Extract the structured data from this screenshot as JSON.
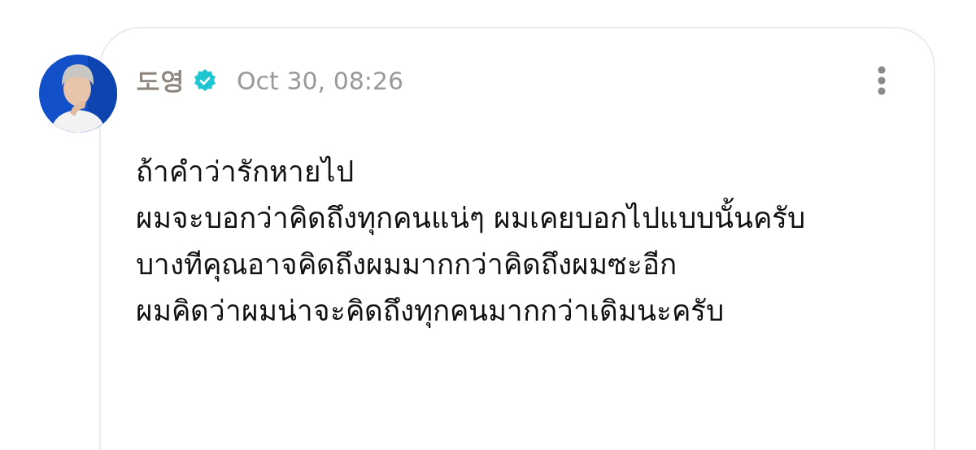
{
  "post": {
    "author": "도영",
    "verified": true,
    "time": "Oct 30, 08:26",
    "body": "ถ้าคำว่ารักหายไป\nผมจะบอกว่าคิดถึงทุกคนแน่ๆ ผมเคยบอกไปแบบนั้นครับ\nบางทีคุณอาจคิดถึงผมมากกว่าคิดถึงผมซะอีก\nผมคิดว่าผมน่าจะคิดถึงทุกคนมากกว่าเดิมนะครับ"
  }
}
